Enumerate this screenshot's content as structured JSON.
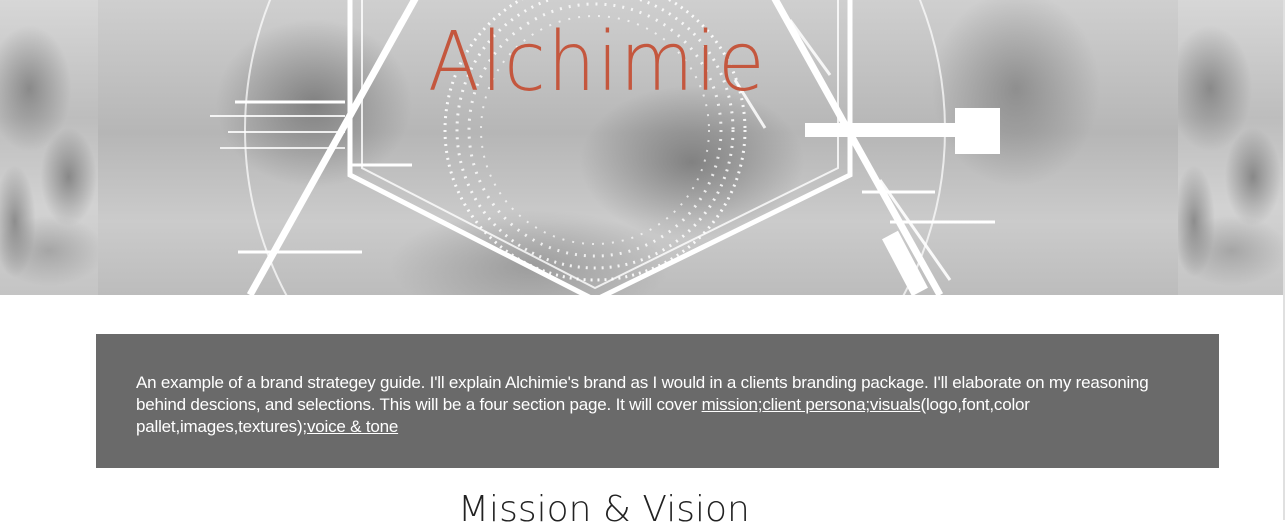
{
  "hero": {
    "brand_title": "Alchimie"
  },
  "intro": {
    "text_part1": "An example of a brand strategey guide. I'll explain Alchimie's brand as I would in a clients branding package. I'll elaborate on my reasoning behind descions, and selections. This will be a four section page. It will cover ",
    "links": [
      {
        "label": "mission;"
      },
      {
        "label": "client persona;"
      },
      {
        "label": "visuals"
      }
    ],
    "text_part2": "(logo,font,color pallet,images,textures)",
    "link_voice": ";voice & tone"
  },
  "sections": {
    "first_heading": "Mission & Vision"
  },
  "colors": {
    "brand_accent": "#c4573e",
    "intro_background": "#6a6a6a"
  }
}
